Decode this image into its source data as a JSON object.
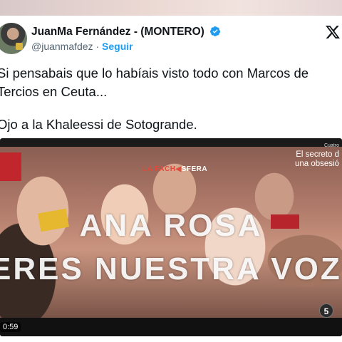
{
  "tweet": {
    "author_name": "JuanMa Fernández - (MONTERO)",
    "handle": "@juanmafdez",
    "separator": "·",
    "follow_label": "Seguir",
    "text_lines": [
      "Si pensabais que lo habíais visto todo con Marcos de",
      "Tercios en Ceuta...",
      "Ojo a la Khaleessi de Sotogrande."
    ]
  },
  "video": {
    "watermark_left": "LA FACH",
    "watermark_right": "SFERA",
    "corner_small": "Cuatro",
    "corner_line1": "El secreto d",
    "corner_line2": "una obsesió",
    "overlay_line1": "ANA ROSA",
    "overlay_line2": "ERES NUESTRA VOZ",
    "timestamp": "0:59",
    "channel_logo": "5"
  },
  "colors": {
    "accent": "#1d9bf0",
    "verified": "#1d9bf0",
    "text": "#0f1419",
    "muted": "#536471"
  }
}
